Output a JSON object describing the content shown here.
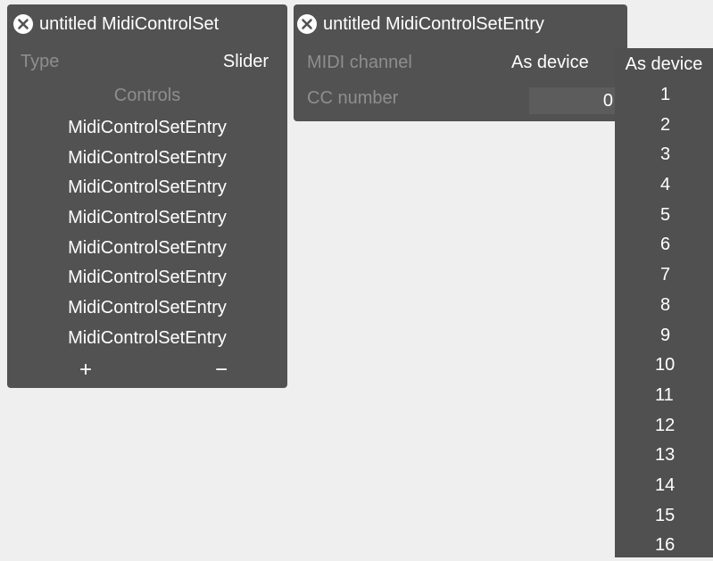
{
  "control_set_panel": {
    "title": "untitled MidiControlSet",
    "type_label": "Type",
    "type_value": "Slider",
    "controls_heading": "Controls",
    "entries": [
      "MidiControlSetEntry",
      "MidiControlSetEntry",
      "MidiControlSetEntry",
      "MidiControlSetEntry",
      "MidiControlSetEntry",
      "MidiControlSetEntry",
      "MidiControlSetEntry",
      "MidiControlSetEntry"
    ],
    "add_label": "+",
    "remove_label": "−"
  },
  "entry_panel": {
    "title": "untitled MidiControlSetEntry",
    "midi_channel_label": "MIDI channel",
    "midi_channel_value": "As device",
    "cc_number_label": "CC number",
    "cc_number_value": "0"
  },
  "channel_dropdown": {
    "selected": "As device",
    "options": [
      "1",
      "2",
      "3",
      "4",
      "5",
      "6",
      "7",
      "8",
      "9",
      "10",
      "11",
      "12",
      "13",
      "14",
      "15",
      "16"
    ]
  },
  "colors": {
    "background": "#efefef",
    "panel": "#525252",
    "label_muted": "#8e8e8e",
    "text": "#ffffff"
  }
}
